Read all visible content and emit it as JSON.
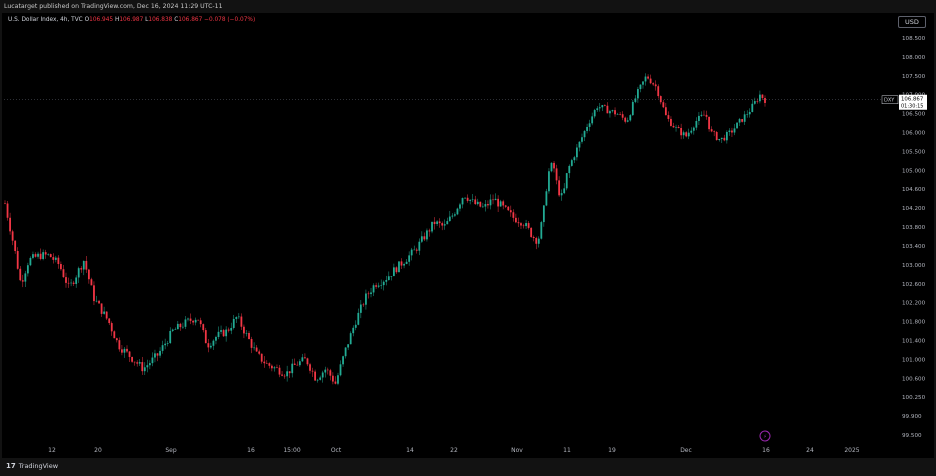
{
  "header": {
    "publish_text": "Lucatarget published on TradingView.com, Dec 16, 2024 11:29 UTC-11"
  },
  "legend": {
    "symbol": "U.S. Dollar Index, 4h, TVC",
    "o_label": "O",
    "o_value": "106.945",
    "h_label": "H",
    "h_value": "106.987",
    "l_label": "L",
    "l_value": "106.838",
    "c_label": "C",
    "c_value": "106.867",
    "change": "−0.078 (−0.07%)"
  },
  "currency_button": "USD",
  "price_tag": {
    "symbol": "DXY",
    "price": "106.867",
    "countdown": "01:30:15"
  },
  "branding": {
    "logo_text": "TradingView",
    "logo_mark": "17"
  },
  "colors": {
    "up": "#22ab94",
    "down": "#f23645",
    "background": "#000000",
    "axis_text": "#b2b5be"
  },
  "chart_data": {
    "type": "candlestick",
    "title": "U.S. Dollar Index, 4h, TVC",
    "ylim": [
      99.5,
      108.7
    ],
    "y_ticks": [
      "108.500",
      "108.000",
      "107.500",
      "107.000",
      "106.500",
      "106.000",
      "105.500",
      "105.000",
      "104.600",
      "104.200",
      "103.800",
      "103.400",
      "103.000",
      "102.600",
      "102.200",
      "101.800",
      "101.400",
      "101.000",
      "100.600",
      "100.250",
      "99.900",
      "99.500"
    ],
    "x_ticks": [
      "12",
      "20",
      "Sep",
      "16",
      "15:00",
      "Oct",
      "14",
      "22",
      "Nov",
      "11",
      "19",
      "Dec",
      "16",
      "24",
      "2025"
    ],
    "last_price": 106.867,
    "price_path": [
      {
        "t": 0.0,
        "v": 104.3
      },
      {
        "t": 0.4,
        "v": 103.9
      },
      {
        "t": 1.0,
        "v": 103.3
      },
      {
        "t": 1.6,
        "v": 102.6
      },
      {
        "t": 2.4,
        "v": 103.1
      },
      {
        "t": 3.5,
        "v": 103.2
      },
      {
        "t": 4.5,
        "v": 103.2
      },
      {
        "t": 5.5,
        "v": 103.0
      },
      {
        "t": 6.5,
        "v": 102.5
      },
      {
        "t": 8.0,
        "v": 103.1
      },
      {
        "t": 9.0,
        "v": 102.3
      },
      {
        "t": 10.5,
        "v": 101.8
      },
      {
        "t": 11.5,
        "v": 101.3
      },
      {
        "t": 12.5,
        "v": 101.1
      },
      {
        "t": 14.0,
        "v": 100.8
      },
      {
        "t": 15.5,
        "v": 101.1
      },
      {
        "t": 17.0,
        "v": 101.6
      },
      {
        "t": 18.5,
        "v": 101.8
      },
      {
        "t": 19.5,
        "v": 101.9
      },
      {
        "t": 20.5,
        "v": 101.3
      },
      {
        "t": 21.5,
        "v": 101.5
      },
      {
        "t": 22.5,
        "v": 101.6
      },
      {
        "t": 23.5,
        "v": 101.9
      },
      {
        "t": 24.5,
        "v": 101.5
      },
      {
        "t": 25.5,
        "v": 101.1
      },
      {
        "t": 26.5,
        "v": 100.9
      },
      {
        "t": 27.5,
        "v": 100.8
      },
      {
        "t": 28.5,
        "v": 100.7
      },
      {
        "t": 29.5,
        "v": 100.9
      },
      {
        "t": 30.5,
        "v": 101.0
      },
      {
        "t": 31.5,
        "v": 100.6
      },
      {
        "t": 32.5,
        "v": 100.8
      },
      {
        "t": 33.5,
        "v": 100.5
      },
      {
        "t": 34.5,
        "v": 101.2
      },
      {
        "t": 35.5,
        "v": 101.8
      },
      {
        "t": 36.5,
        "v": 102.3
      },
      {
        "t": 37.5,
        "v": 102.6
      },
      {
        "t": 38.5,
        "v": 102.7
      },
      {
        "t": 39.5,
        "v": 102.9
      },
      {
        "t": 40.5,
        "v": 103.1
      },
      {
        "t": 41.5,
        "v": 103.3
      },
      {
        "t": 42.5,
        "v": 103.6
      },
      {
        "t": 43.5,
        "v": 103.9
      },
      {
        "t": 44.5,
        "v": 103.8
      },
      {
        "t": 45.5,
        "v": 104.1
      },
      {
        "t": 46.5,
        "v": 104.5
      },
      {
        "t": 47.5,
        "v": 104.3
      },
      {
        "t": 48.5,
        "v": 104.2
      },
      {
        "t": 49.5,
        "v": 104.4
      },
      {
        "t": 50.5,
        "v": 104.2
      },
      {
        "t": 51.5,
        "v": 104.0
      },
      {
        "t": 52.5,
        "v": 103.9
      },
      {
        "t": 53.5,
        "v": 103.6
      },
      {
        "t": 54.0,
        "v": 103.5
      },
      {
        "t": 54.5,
        "v": 104.0
      },
      {
        "t": 55.0,
        "v": 104.9
      },
      {
        "t": 55.5,
        "v": 105.2
      },
      {
        "t": 56.0,
        "v": 104.6
      },
      {
        "t": 56.5,
        "v": 104.4
      },
      {
        "t": 57.0,
        "v": 105.0
      },
      {
        "t": 58.0,
        "v": 105.6
      },
      {
        "t": 59.0,
        "v": 106.2
      },
      {
        "t": 60.0,
        "v": 106.7
      },
      {
        "t": 61.0,
        "v": 106.6
      },
      {
        "t": 62.0,
        "v": 106.5
      },
      {
        "t": 63.0,
        "v": 106.3
      },
      {
        "t": 64.0,
        "v": 107.0
      },
      {
        "t": 65.0,
        "v": 107.5
      },
      {
        "t": 66.0,
        "v": 107.2
      },
      {
        "t": 66.5,
        "v": 106.8
      },
      {
        "t": 67.0,
        "v": 106.4
      },
      {
        "t": 68.0,
        "v": 106.1
      },
      {
        "t": 69.0,
        "v": 105.9
      },
      {
        "t": 70.0,
        "v": 106.3
      },
      {
        "t": 71.0,
        "v": 106.5
      },
      {
        "t": 71.5,
        "v": 106.0
      },
      {
        "t": 72.5,
        "v": 105.8
      },
      {
        "t": 73.5,
        "v": 106.0
      },
      {
        "t": 74.5,
        "v": 106.3
      },
      {
        "t": 75.5,
        "v": 106.6
      },
      {
        "t": 76.5,
        "v": 107.0
      },
      {
        "t": 77.0,
        "v": 106.87
      }
    ]
  }
}
